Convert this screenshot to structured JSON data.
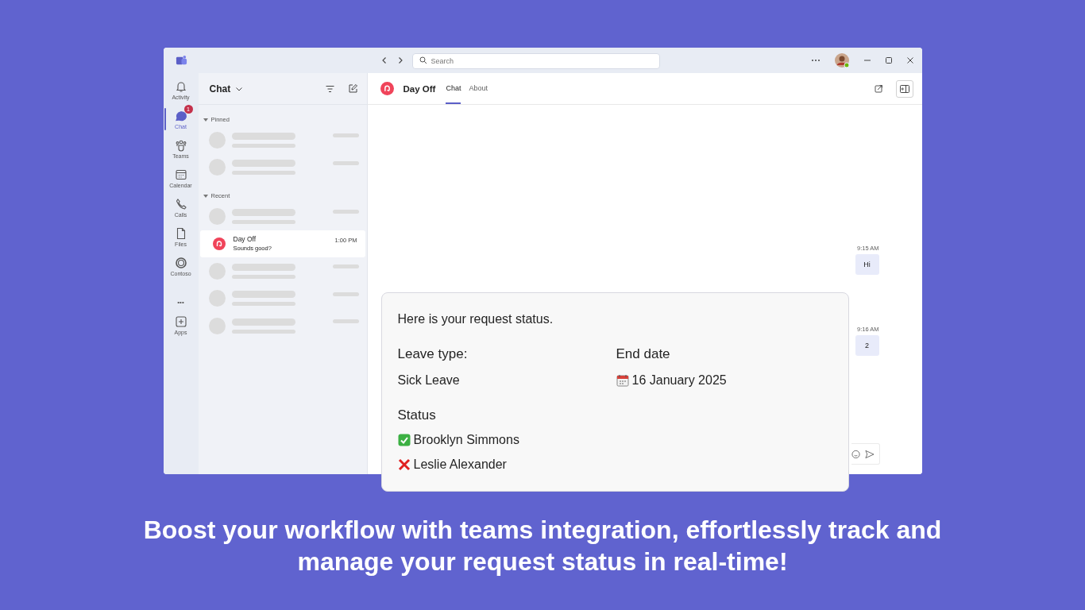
{
  "window": {
    "search": {
      "placeholder": "Search"
    }
  },
  "rail": [
    {
      "label": "Activity",
      "kind": "bell",
      "selected": false
    },
    {
      "label": "Chat",
      "kind": "chat",
      "selected": true,
      "badge": "1"
    },
    {
      "label": "Teams",
      "kind": "teams",
      "selected": false
    },
    {
      "label": "Calendar",
      "kind": "calendar",
      "selected": false
    },
    {
      "label": "Calls",
      "kind": "calls",
      "selected": false
    },
    {
      "label": "Files",
      "kind": "files",
      "selected": false
    },
    {
      "label": "Contoso",
      "kind": "ring",
      "selected": false
    },
    {
      "label": "•••",
      "kind": "more",
      "selected": false
    },
    {
      "label": "Apps",
      "kind": "apps",
      "selected": false
    }
  ],
  "chat_list": {
    "title": "Chat",
    "sections": [
      {
        "label": "Pinned",
        "items": [
          {
            "kind": "skeleton",
            "selected": false
          },
          {
            "kind": "skeleton",
            "selected": false
          }
        ]
      },
      {
        "label": "Recent",
        "items": [
          {
            "kind": "skeleton",
            "selected": false
          },
          {
            "kind": "chat",
            "name": "Day Off",
            "preview": "Sounds good?",
            "time": "1:00 PM",
            "selected": true
          },
          {
            "kind": "skeleton",
            "selected": false
          },
          {
            "kind": "skeleton",
            "selected": false
          },
          {
            "kind": "skeleton",
            "selected": false
          }
        ]
      }
    ]
  },
  "conversation": {
    "title": "Day Off",
    "tabs": [
      {
        "label": "Chat",
        "selected": true
      },
      {
        "label": "About",
        "selected": false
      }
    ],
    "messages": [
      {
        "time": "9:15 AM",
        "text": "Hi"
      },
      {
        "time": "9:16 AM",
        "text": "2"
      }
    ]
  },
  "card": {
    "heading": "Here is your request status.",
    "fields": [
      {
        "label": "Leave type:",
        "value": "Sick Leave",
        "kind": "text"
      },
      {
        "label": "End date",
        "value": "16 January 2025",
        "kind": "date"
      }
    ],
    "status_label": "Status",
    "approvers": [
      {
        "name": "Brooklyn Simmons",
        "kind": "approved"
      },
      {
        "name": "Leslie Alexander",
        "kind": "rejected"
      }
    ]
  },
  "headline": "Boost your workflow with teams integration, effortlessly track and manage your request status in real-time!"
}
